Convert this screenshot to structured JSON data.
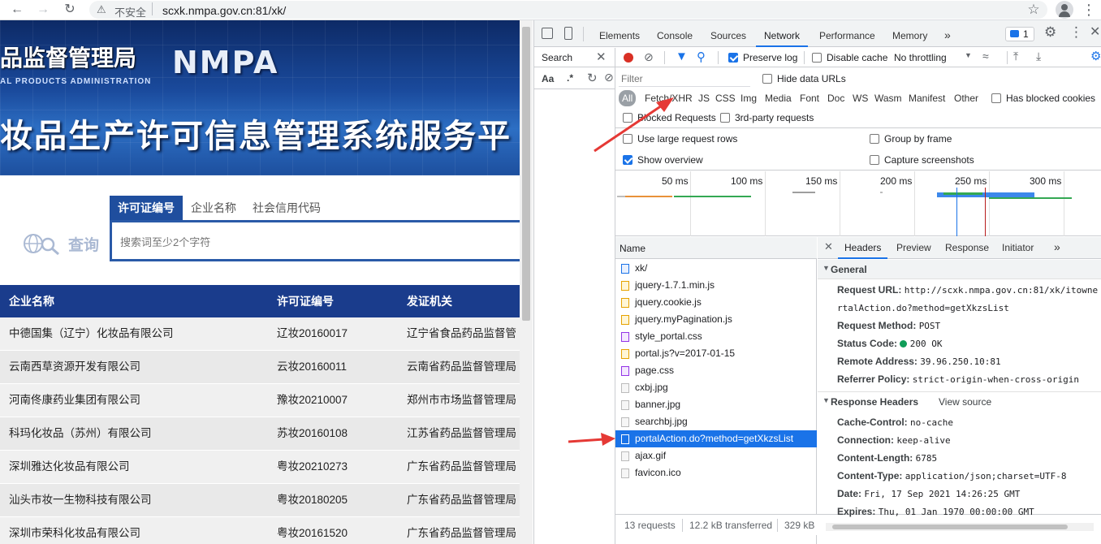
{
  "browser": {
    "security_label": "不安全",
    "url": "scxk.nmpa.gov.cn:81/xk/"
  },
  "page": {
    "banner": {
      "org_cn": "品监督管理局",
      "org_en_logo": "NMPA",
      "org_en_sub": "AL PRODUCTS ADMINISTRATION",
      "system_title": "妆品生产许可信息管理系统服务平"
    },
    "search": {
      "tabs": [
        "许可证编号",
        "企业名称",
        "社会信用代码"
      ],
      "active_tab": 0,
      "placeholder": "搜索词至少2个字符",
      "label": "查询"
    },
    "table": {
      "headers": [
        "企业名称",
        "许可证编号",
        "发证机关"
      ],
      "rows": [
        [
          "中德国集（辽宁）化妆品有限公司",
          "辽妆20160017",
          "辽宁省食品药品监督管"
        ],
        [
          "云南西草资源开发有限公司",
          "云妆20160011",
          "云南省药品监督管理局"
        ],
        [
          "河南佟康药业集团有限公司",
          "豫妆20210007",
          "郑州市市场监督管理局"
        ],
        [
          "科玛化妆品（苏州）有限公司",
          "苏妆20160108",
          "江苏省药品监督管理局"
        ],
        [
          "深圳雅达化妆品有限公司",
          "粤妆20210273",
          "广东省药品监督管理局"
        ],
        [
          "汕头市妆一生物科技有限公司",
          "粤妆20180205",
          "广东省药品监督管理局"
        ],
        [
          "深圳市荣科化妆品有限公司",
          "粤妆20161520",
          "广东省药品监督管理局"
        ]
      ]
    }
  },
  "devtools": {
    "tabs": [
      "Elements",
      "Console",
      "Sources",
      "Network",
      "Performance",
      "Memory"
    ],
    "active_tab": "Network",
    "issues_count": "1",
    "search_label": "Search",
    "aa_label": "Aa",
    "regex_label": ".*",
    "toolbar": {
      "preserve_log": "Preserve log",
      "disable_cache": "Disable cache",
      "throttling": "No throttling"
    },
    "filter": {
      "placeholder": "Filter",
      "hide_data_urls": "Hide data URLs",
      "types": [
        "All",
        "Fetch/XHR",
        "JS",
        "CSS",
        "Img",
        "Media",
        "Font",
        "Doc",
        "WS",
        "Wasm",
        "Manifest",
        "Other"
      ],
      "has_blocked_cookies": "Has blocked cookies",
      "blocked_requests": "Blocked Requests",
      "third_party": "3rd-party requests",
      "large_rows": "Use large request rows",
      "group_by_frame": "Group by frame",
      "show_overview": "Show overview",
      "capture_screenshots": "Capture screenshots"
    },
    "timeline_ticks": [
      "50 ms",
      "100 ms",
      "150 ms",
      "200 ms",
      "250 ms",
      "300 ms"
    ],
    "requests_header": "Name",
    "requests": [
      {
        "name": "xk/",
        "type": "doc"
      },
      {
        "name": "jquery-1.7.1.min.js",
        "type": "js"
      },
      {
        "name": "jquery.cookie.js",
        "type": "js"
      },
      {
        "name": "jquery.myPagination.js",
        "type": "js"
      },
      {
        "name": "style_portal.css",
        "type": "css"
      },
      {
        "name": "portal.js?v=2017-01-15",
        "type": "js"
      },
      {
        "name": "page.css",
        "type": "css"
      },
      {
        "name": "cxbj.jpg",
        "type": "img"
      },
      {
        "name": "banner.jpg",
        "type": "img"
      },
      {
        "name": "searchbj.jpg",
        "type": "img"
      },
      {
        "name": "portalAction.do?method=getXkzsList",
        "type": "xhr",
        "selected": true
      },
      {
        "name": "ajax.gif",
        "type": "img"
      },
      {
        "name": "favicon.ico",
        "type": "img"
      }
    ],
    "status_bar": {
      "requests": "13 requests",
      "transferred": "12.2 kB transferred",
      "resources": "329 kB"
    },
    "detail_tabs": [
      "Headers",
      "Preview",
      "Response",
      "Initiator"
    ],
    "general": {
      "title": "General",
      "request_url_key": "Request URL:",
      "request_url_val": "http://scxk.nmpa.gov.cn:81/xk/itowne",
      "request_url_val2": "rtalAction.do?method=getXkzsList",
      "request_method_key": "Request Method:",
      "request_method_val": "POST",
      "status_code_key": "Status Code:",
      "status_code_val": "200 OK",
      "remote_address_key": "Remote Address:",
      "remote_address_val": "39.96.250.10:81",
      "referrer_policy_key": "Referrer Policy:",
      "referrer_policy_val": "strict-origin-when-cross-origin"
    },
    "response_headers": {
      "title": "Response Headers",
      "view_source": "View source",
      "rows": [
        {
          "k": "Cache-Control:",
          "v": "no-cache"
        },
        {
          "k": "Connection:",
          "v": "keep-alive"
        },
        {
          "k": "Content-Length:",
          "v": "6785"
        },
        {
          "k": "Content-Type:",
          "v": "application/json;charset=UTF-8"
        },
        {
          "k": "Date:",
          "v": "Fri, 17 Sep 2021 14:26:25 GMT"
        },
        {
          "k": "Expires:",
          "v": "Thu, 01 Jan 1970 00:00:00 GMT"
        }
      ]
    }
  },
  "colors": {
    "accent": "#1a73e8",
    "table_header": "#1a3c8c",
    "annotation_arrow": "#e53935",
    "status_ok": "#0f9d58"
  }
}
